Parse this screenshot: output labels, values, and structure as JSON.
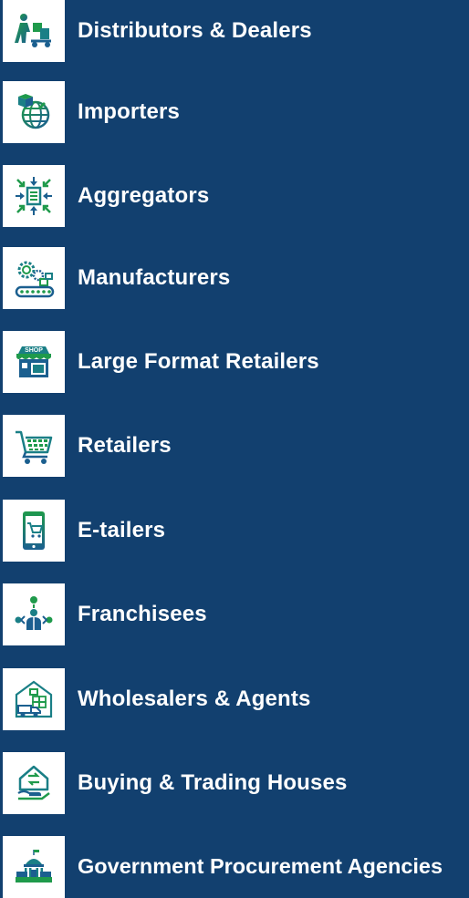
{
  "theme": {
    "background": "#12406f",
    "tile": "#ffffff",
    "icon_green": "#1f9a4b",
    "icon_teal": "#1a7f86",
    "icon_blue": "#1b5f8f",
    "text": "#ffffff"
  },
  "items": [
    {
      "label": "Distributors & Dealers",
      "icon": "hand-truck-icon"
    },
    {
      "label": "Importers",
      "icon": "globe-package-icon"
    },
    {
      "label": "Aggregators",
      "icon": "arrows-to-center-icon"
    },
    {
      "label": "Manufacturers",
      "icon": "gear-conveyor-icon"
    },
    {
      "label": "Large Format Retailers",
      "icon": "shop-storefront-icon"
    },
    {
      "label": "Retailers",
      "icon": "shopping-cart-icon"
    },
    {
      "label": "E-tailers",
      "icon": "mobile-cart-icon"
    },
    {
      "label": "Franchisees",
      "icon": "person-network-icon"
    },
    {
      "label": "Wholesalers & Agents",
      "icon": "warehouse-truck-icon"
    },
    {
      "label": "Buying & Trading Houses",
      "icon": "house-exchange-icon"
    },
    {
      "label": "Government Procurement Agencies",
      "icon": "government-building-icon"
    }
  ]
}
